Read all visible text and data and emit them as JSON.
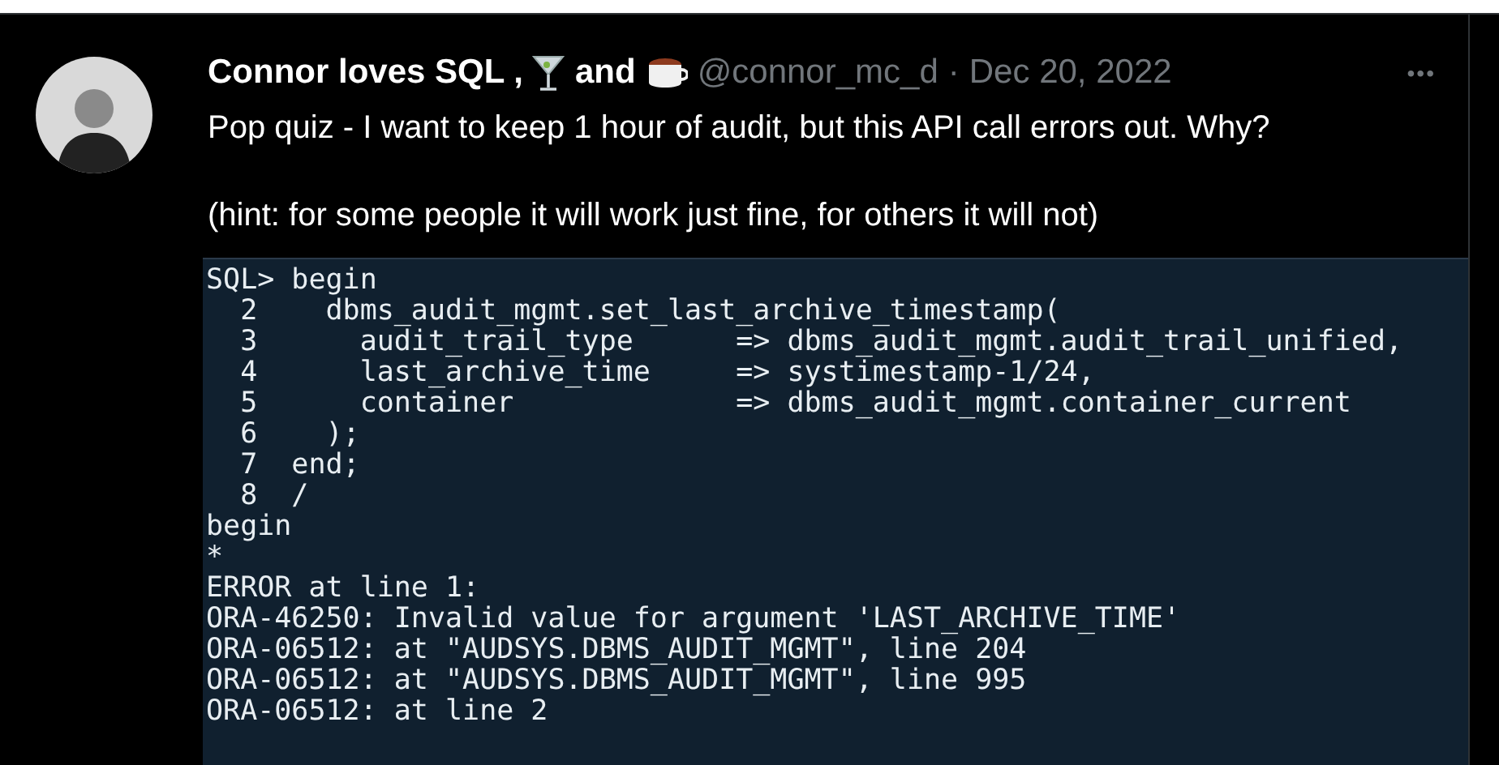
{
  "tweet": {
    "author_name_start": "Connor loves SQL ,",
    "author_name_middle": "and",
    "handle": "@connor_mc_d",
    "separator": "·",
    "date": "Dec 20, 2022",
    "more": "•••",
    "paragraphs": [
      "Pop quiz - I want to keep 1 hour of audit, but this API call errors out. Why?",
      "(hint: for some people it will work just fine, for others it will not)"
    ],
    "terminal_lines": [
      "SQL> begin",
      "  2    dbms_audit_mgmt.set_last_archive_timestamp(",
      "  3      audit_trail_type      => dbms_audit_mgmt.audit_trail_unified,",
      "  4      last_archive_time     => systimestamp-1/24,",
      "  5      container             => dbms_audit_mgmt.container_current",
      "  6    );",
      "  7  end;",
      "  8  /",
      "begin",
      "*",
      "ERROR at line 1:",
      "ORA-46250: Invalid value for argument 'LAST_ARCHIVE_TIME'",
      "ORA-06512: at \"AUDSYS.DBMS_AUDIT_MGMT\", line 204",
      "ORA-06512: at \"AUDSYS.DBMS_AUDIT_MGMT\", line 995",
      "ORA-06512: at line 2"
    ]
  }
}
